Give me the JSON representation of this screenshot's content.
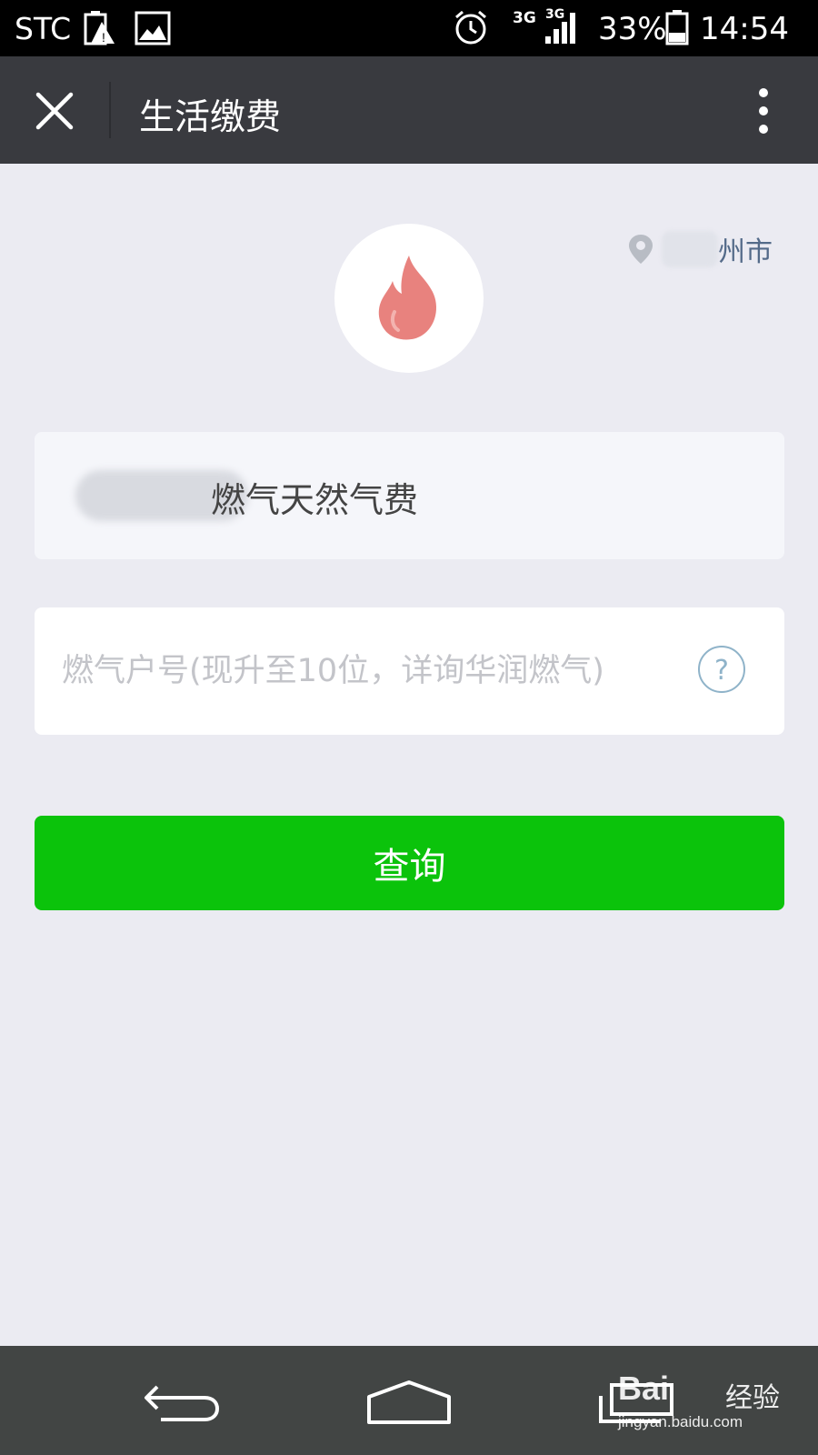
{
  "status_bar": {
    "carrier": "STC",
    "network_left": "3G",
    "network_right": "3G",
    "battery_percent": "33%",
    "time": "14:54",
    "icons": [
      "battery-alert-icon",
      "image-icon",
      "alarm-icon",
      "signal-icon",
      "battery-icon"
    ]
  },
  "title_bar": {
    "title": "生活缴费",
    "close_icon": "close-icon",
    "more_icon": "more-vertical-icon"
  },
  "location": {
    "icon": "location-pin-icon",
    "city": "州市"
  },
  "service": {
    "icon": "flame-icon",
    "flame_color": "#e8827e"
  },
  "provider": {
    "label": "燃气天然气费"
  },
  "account": {
    "value": "",
    "placeholder": "燃气户号(现升至10位，详询华润燃气)",
    "help_icon": "question-icon",
    "help_glyph": "?"
  },
  "query_button": {
    "label": "查询",
    "color": "#0bc30b"
  },
  "nav_bar": {
    "buttons": [
      "back-icon",
      "home-icon",
      "recent-apps-icon"
    ]
  },
  "watermark": {
    "logo": "Bai",
    "brand": "经验",
    "url": "jingyan.baidu.com"
  }
}
